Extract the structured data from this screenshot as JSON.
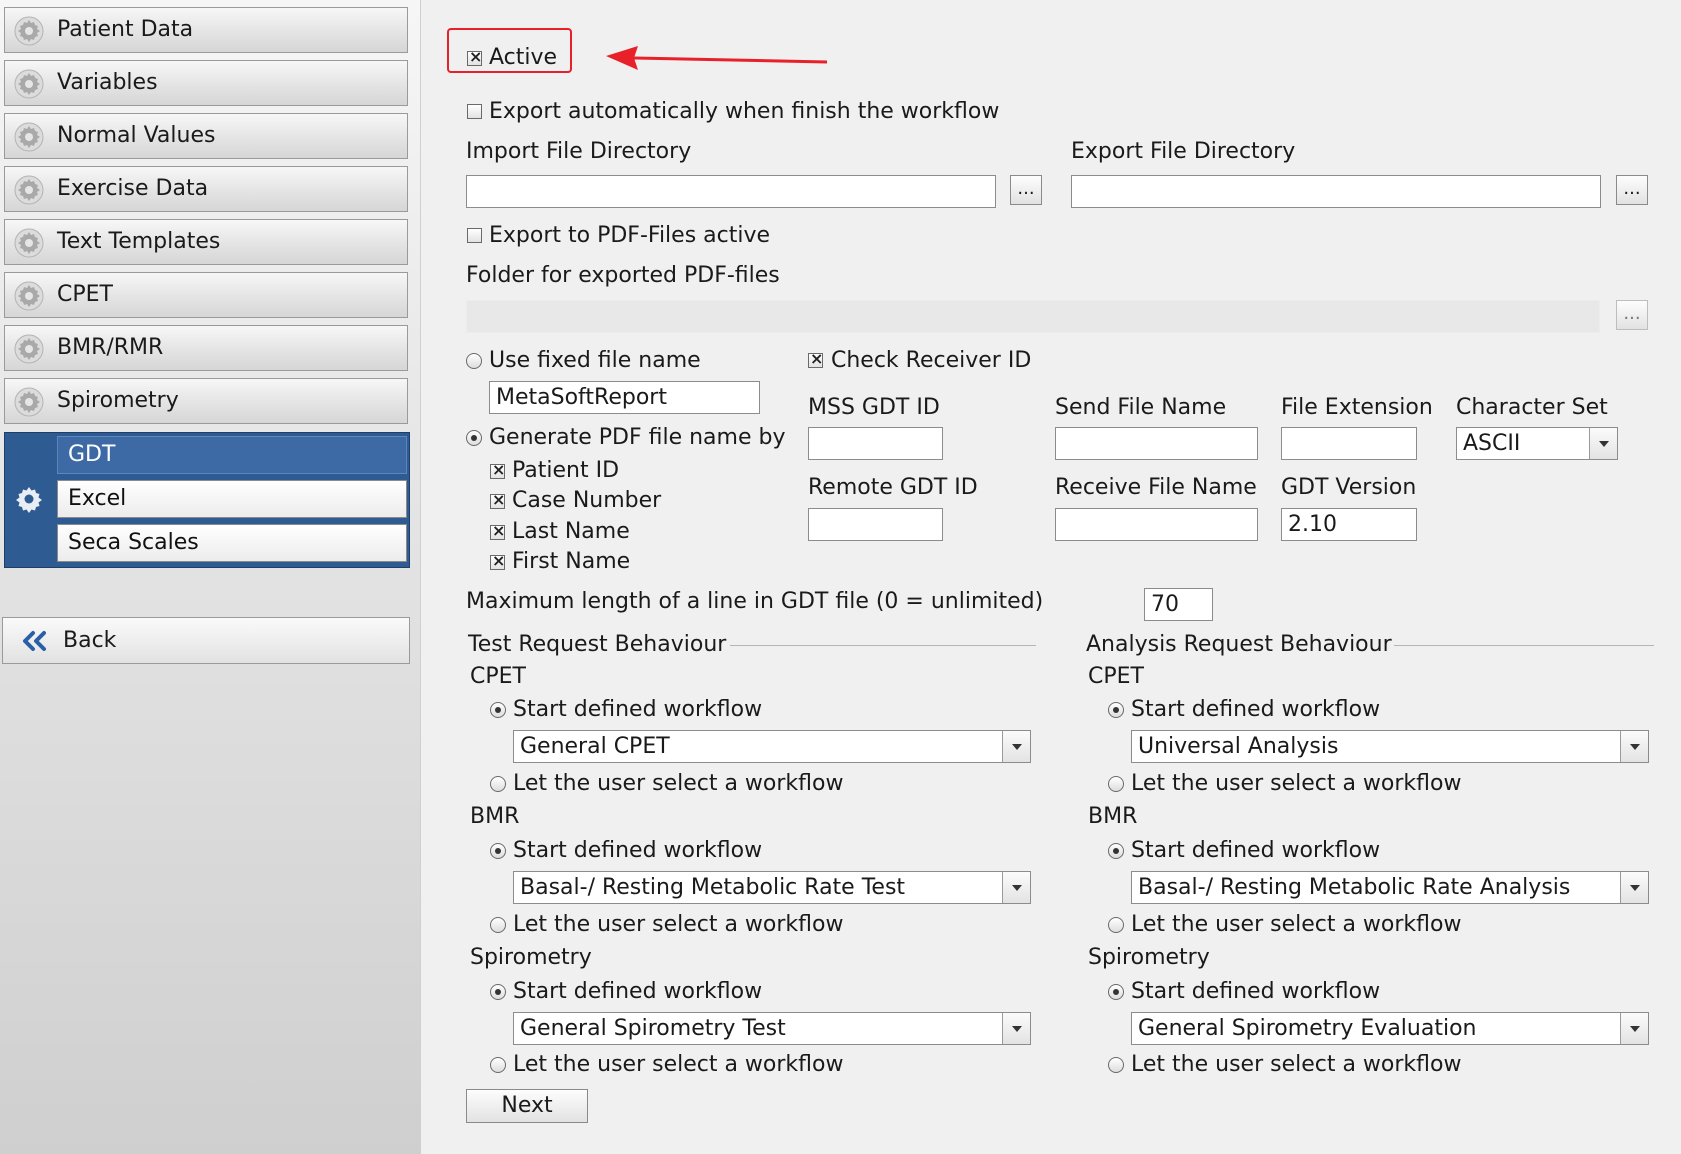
{
  "sidebar": {
    "items": [
      {
        "label": "Patient Data"
      },
      {
        "label": "Variables"
      },
      {
        "label": "Normal Values"
      },
      {
        "label": "Exercise Data"
      },
      {
        "label": "Text Templates"
      },
      {
        "label": "CPET"
      },
      {
        "label": "BMR/RMR"
      },
      {
        "label": "Spirometry"
      }
    ],
    "gdt_group": {
      "items": [
        {
          "label": "GDT",
          "selected": true
        },
        {
          "label": "Excel",
          "selected": false
        },
        {
          "label": "Seca Scales",
          "selected": false
        }
      ]
    },
    "back_label": "Back"
  },
  "form": {
    "active": {
      "label": "Active",
      "checked": true
    },
    "export_auto": {
      "label": "Export automatically when finish the workflow",
      "checked": false
    },
    "import_dir": {
      "label": "Import File Directory",
      "value": "",
      "button": "..."
    },
    "export_dir": {
      "label": "Export File Directory",
      "value": "",
      "button": "..."
    },
    "export_pdf": {
      "label": "Export to PDF-Files active",
      "checked": false
    },
    "pdf_folder": {
      "label": "Folder for exported PDF-files",
      "value": "",
      "button": "..."
    },
    "fixed_name": {
      "label": "Use fixed file name",
      "checked": false,
      "value": "MetaSoftReport"
    },
    "generate_name": {
      "label": "Generate PDF file name by",
      "checked": true,
      "options": [
        {
          "label": "Patient ID",
          "checked": true
        },
        {
          "label": "Case Number",
          "checked": true
        },
        {
          "label": "Last Name",
          "checked": true
        },
        {
          "label": "First Name",
          "checked": true
        }
      ]
    },
    "check_receiver": {
      "label": "Check Receiver ID",
      "checked": true
    },
    "mss_gdt_id": {
      "label": "MSS GDT ID",
      "value": ""
    },
    "remote_gdt_id": {
      "label": "Remote GDT ID",
      "value": ""
    },
    "send_file_name": {
      "label": "Send File Name",
      "value": ""
    },
    "receive_file_name": {
      "label": "Receive File Name",
      "value": ""
    },
    "file_extension": {
      "label": "File Extension",
      "value": ""
    },
    "gdt_version": {
      "label": "GDT Version",
      "value": "2.10"
    },
    "charset": {
      "label": "Character Set",
      "value": "ASCII"
    },
    "max_line": {
      "label": "Maximum length of a line in GDT file (0 = unlimited)",
      "value": "70"
    },
    "test_request": {
      "title": "Test Request Behaviour",
      "sections": [
        {
          "name": "CPET",
          "start_label": "Start defined workflow",
          "start_checked": true,
          "workflow": "General CPET",
          "user_label": "Let the user select a workflow",
          "user_checked": false
        },
        {
          "name": "BMR",
          "start_label": "Start defined workflow",
          "start_checked": true,
          "workflow": "Basal-/ Resting Metabolic Rate Test",
          "user_label": "Let the user select a workflow",
          "user_checked": false
        },
        {
          "name": "Spirometry",
          "start_label": "Start defined workflow",
          "start_checked": true,
          "workflow": "General Spirometry Test",
          "user_label": "Let the user select a workflow",
          "user_checked": false
        }
      ]
    },
    "analysis_request": {
      "title": "Analysis Request Behaviour",
      "sections": [
        {
          "name": "CPET",
          "start_label": "Start defined workflow",
          "start_checked": true,
          "workflow": "Universal Analysis",
          "user_label": "Let the user select a workflow",
          "user_checked": false
        },
        {
          "name": "BMR",
          "start_label": "Start defined workflow",
          "start_checked": true,
          "workflow": "Basal-/ Resting Metabolic Rate Analysis",
          "user_label": "Let the user select a workflow",
          "user_checked": false
        },
        {
          "name": "Spirometry",
          "start_label": "Start defined workflow",
          "start_checked": true,
          "workflow": "General Spirometry Evaluation",
          "user_label": "Let the user select a workflow",
          "user_checked": false
        }
      ]
    },
    "next_label": "Next"
  },
  "annotation": {
    "highlight_color": "#e8202a"
  },
  "colors": {
    "accent": "#2f5b93",
    "selected_item": "#3d6aa5"
  },
  "icons": {
    "nav": "gear-icon",
    "back": "double-chevron-left-icon"
  }
}
